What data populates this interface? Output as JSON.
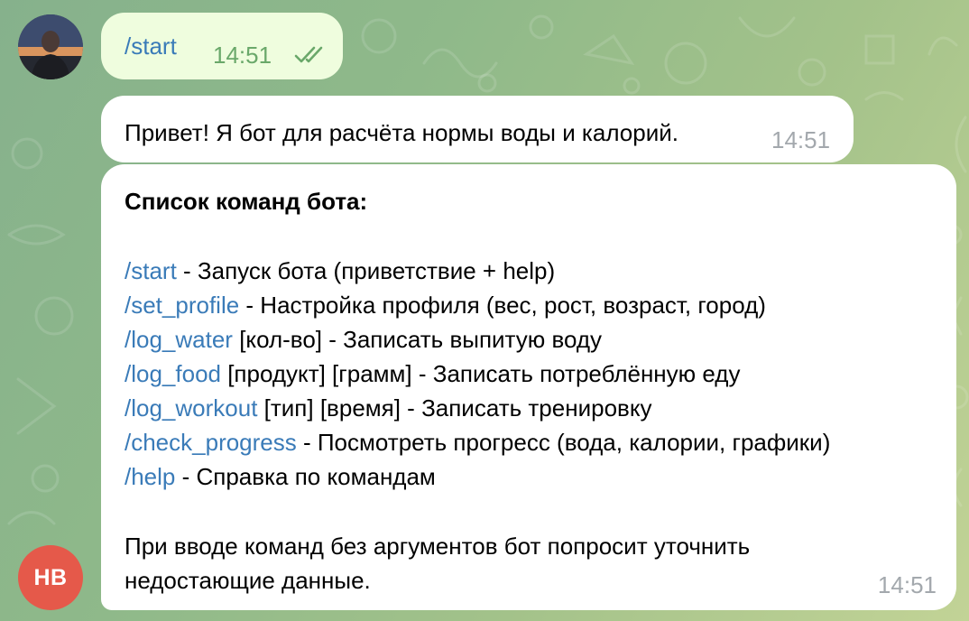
{
  "messages": {
    "outgoing": {
      "text": "/start",
      "time": "14:51",
      "status": "read"
    },
    "hello": {
      "text": "Привет! Я бот для расчёта нормы воды и калорий.",
      "time": "14:51"
    },
    "commands": {
      "title": "Список команд бота:",
      "items": [
        {
          "command": "/start",
          "description": " - Запуск бота (приветствие + help)"
        },
        {
          "command": "/set_profile",
          "description": " - Настройка профиля (вес, рост, возраст, город)"
        },
        {
          "command": "/log_water",
          "description": " [кол-во] - Записать выпитую воду"
        },
        {
          "command": "/log_food",
          "description": " [продукт] [грамм] - Записать потреблённую еду"
        },
        {
          "command": "/log_workout",
          "description": " [тип] [время] - Записать тренировку"
        },
        {
          "command": "/check_progress",
          "description": " - Посмотреть прогресс (вода, калории, графики)"
        },
        {
          "command": "/help",
          "description": " - Справка по командам"
        }
      ],
      "note_line1": "При вводе команд без аргументов бот попросит уточнить",
      "note_line2": "недостающие данные.",
      "time": "14:51"
    }
  },
  "bot_avatar": {
    "initials": "HB",
    "color": "#e5594a"
  },
  "colors": {
    "link": "#3a7bb8",
    "outgoing_bubble": "#effdde",
    "read_check": "#6aa86a"
  },
  "icons": {
    "read_status": "double-check-icon",
    "user_avatar": "user-avatar"
  }
}
